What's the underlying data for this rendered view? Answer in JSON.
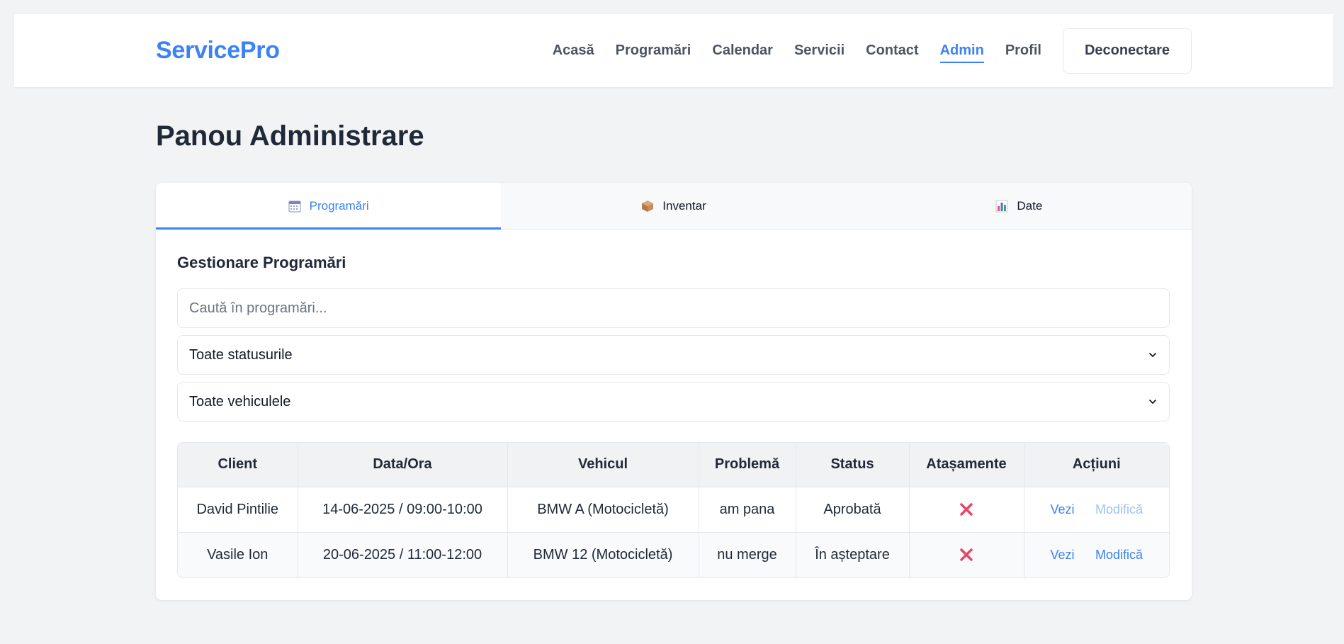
{
  "header": {
    "brand": "ServicePro",
    "nav": [
      "Acasă",
      "Programări",
      "Calendar",
      "Servicii",
      "Contact",
      "Admin",
      "Profil"
    ],
    "active_nav": "Admin",
    "logout_label": "Deconectare"
  },
  "page": {
    "title": "Panou Administrare"
  },
  "tabs": [
    {
      "label": "Programări",
      "icon": "calendar-icon",
      "active": true
    },
    {
      "label": "Inventar",
      "icon": "box-icon",
      "active": false
    },
    {
      "label": "Date",
      "icon": "bar-chart-icon",
      "active": false
    }
  ],
  "section": {
    "title": "Gestionare Programări",
    "search_placeholder": "Caută în programări...",
    "status_filter": "Toate statusurile",
    "vehicle_filter": "Toate vehiculele"
  },
  "table": {
    "columns": [
      "Client",
      "Data/Ora",
      "Vehicul",
      "Problemă",
      "Status",
      "Atașamente",
      "Acțiuni"
    ],
    "rows": [
      {
        "client": "David Pintilie",
        "datetime": "14-06-2025 / 09:00-10:00",
        "vehicle": "BMW A (Motocicletă)",
        "problem": "am pana",
        "status": "Aprobată",
        "attachments": "none",
        "view_label": "Vezi",
        "edit_label": "Modifică",
        "edit_enabled": false
      },
      {
        "client": "Vasile Ion",
        "datetime": "20-06-2025 / 11:00-12:00",
        "vehicle": "BMW 12 (Motocicletă)",
        "problem": "nu merge",
        "status": "În așteptare",
        "attachments": "none",
        "view_label": "Vezi",
        "edit_label": "Modifică",
        "edit_enabled": true
      }
    ]
  },
  "colors": {
    "accent": "#3b82f6",
    "background": "#f2f3f5",
    "no_attachment": "#e8456b"
  }
}
